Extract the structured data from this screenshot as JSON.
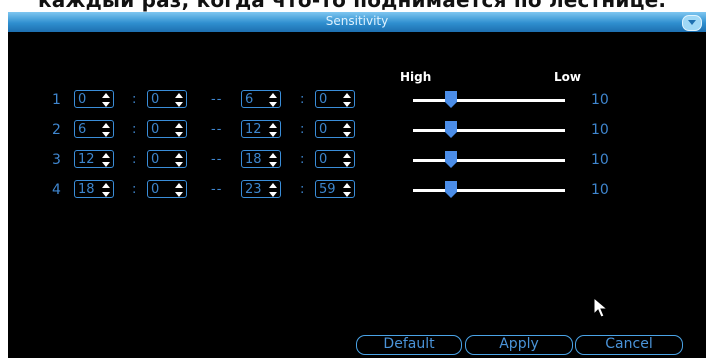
{
  "caption": "каждый раз, когда что-то поднимается по лестнице.",
  "window": {
    "title": "Sensitivity"
  },
  "headers": {
    "high": "High",
    "low": "Low"
  },
  "schedule": [
    {
      "index": "1",
      "start_hour": "0",
      "start_min": "0",
      "end_hour": "6",
      "end_min": "0",
      "level": "10",
      "slider": 0.25
    },
    {
      "index": "2",
      "start_hour": "6",
      "start_min": "0",
      "end_hour": "12",
      "end_min": "0",
      "level": "10",
      "slider": 0.25
    },
    {
      "index": "3",
      "start_hour": "12",
      "start_min": "0",
      "end_hour": "18",
      "end_min": "0",
      "level": "10",
      "slider": 0.25
    },
    {
      "index": "4",
      "start_hour": "18",
      "start_min": "0",
      "end_hour": "23",
      "end_min": "59",
      "level": "10",
      "slider": 0.25
    }
  ],
  "separators": {
    "colon": ":",
    "dash": "--"
  },
  "buttons": {
    "default": "Default",
    "apply": "Apply",
    "cancel": "Cancel"
  },
  "icons": {
    "close": "chevron-down-icon",
    "cursor": "mouse-pointer-icon",
    "spin": "spinner-arrows-icon"
  },
  "colors": {
    "accent": "#3a8dd8",
    "title_bar": "#2f8fcf",
    "background": "#000000",
    "text": "#3f86cf"
  }
}
